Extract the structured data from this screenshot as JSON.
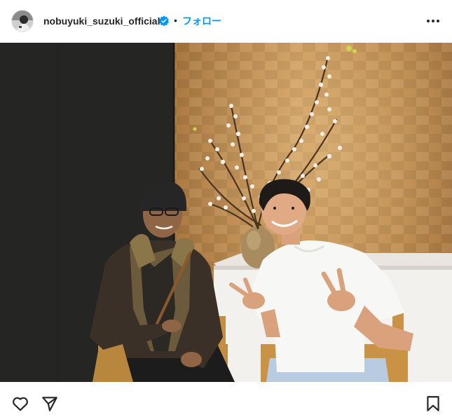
{
  "post": {
    "username": "nobuyuki_suzuki_official",
    "separator": "•",
    "follow_label": "フォロー",
    "verified": true
  },
  "icons": {
    "avatar": "avatar",
    "verified": "verified-badge-icon",
    "more": "more-options-icon",
    "like": "heart-icon",
    "share": "send-icon",
    "save": "bookmark-icon"
  },
  "colors": {
    "link": "#0095f6",
    "verified": "#0095f6",
    "text": "#262626"
  }
}
